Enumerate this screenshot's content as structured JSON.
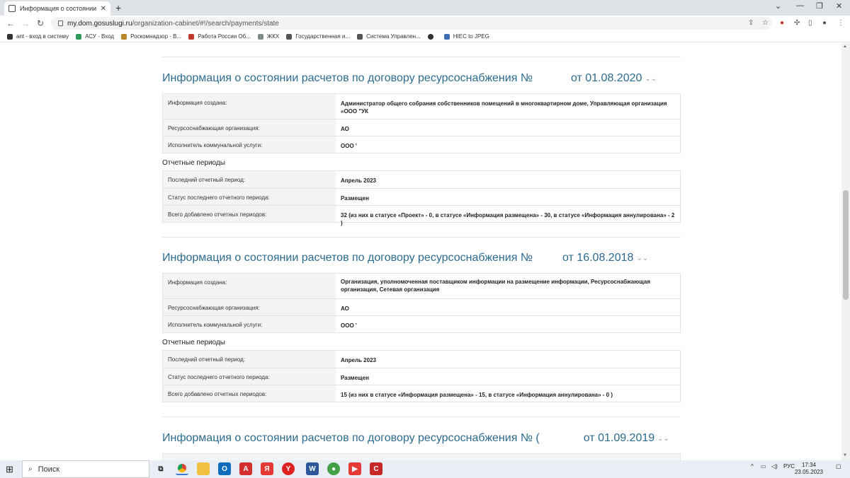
{
  "browser": {
    "tab_title": "Информация о состоянии расч",
    "url_host": "my.dom.gosuslugi.ru",
    "url_path": "/organization-cabinet/#!/search/payments/state",
    "bookmarks": [
      "ant - вход в систему",
      "АСУ - Вход",
      "Роскомнадзор - В...",
      "Работа России Об...",
      "ЖКХ",
      "Государственная и...",
      "Система Управлен...",
      "",
      "HIEC to JPEG"
    ]
  },
  "sections": [
    {
      "title_prefix": "Информация о состоянии расчетов по договору ресурсоснабжения №",
      "title_date": "от 01.08.2020",
      "info_rows": [
        {
          "label": "Информация создана:",
          "value": "Администратор общего собрания собственников помещений в многоквартирном доме, Управляющая организация «ООО \"УК"
        },
        {
          "label": "Ресурсоснабжающая организация:",
          "value": "АО"
        },
        {
          "label": "Исполнитель коммунальной услуги:",
          "value": "ООО '"
        }
      ],
      "periods_heading": "Отчетные периоды",
      "period_rows": [
        {
          "label": "Последний отчетный период:",
          "value": "Апрель 2023"
        },
        {
          "label": "Статус последнего отчетного периода:",
          "value": "Размещен"
        },
        {
          "label": "Всего добавлено отчетных периодов:",
          "value": "32 (из них в статусе «Проект» - 0, в статусе «Информация размещена» - 30, в статусе «Информация аннулирована» - 2 )"
        }
      ]
    },
    {
      "title_prefix": "Информация о состоянии расчетов по договору ресурсоснабжения №",
      "title_date": "от 16.08.2018",
      "info_rows": [
        {
          "label": "Информация создана:",
          "value": "Организация, уполномоченная поставщиком информации на размещение информации, Ресурсоснабжающая организация, Сетевая организация"
        },
        {
          "label": "Ресурсоснабжающая организация:",
          "value": "АО"
        },
        {
          "label": "Исполнитель коммунальной услуги:",
          "value": "ООО '"
        }
      ],
      "periods_heading": "Отчетные периоды",
      "period_rows": [
        {
          "label": "Последний отчетный период:",
          "value": "Апрель 2023"
        },
        {
          "label": "Статус последнего отчетного периода:",
          "value": "Размещен"
        },
        {
          "label": "Всего добавлено отчетных периодов:",
          "value": "15 (из них в статусе «Информация размещена» - 15, в статусе «Информация аннулирована» - 0 )"
        }
      ]
    },
    {
      "title_prefix": "Информация о состоянии расчетов по договору ресурсоснабжения № (",
      "title_date": "от 01.09.2019"
    }
  ],
  "taskbar": {
    "search_placeholder": "Поиск",
    "language": "РУС",
    "time": "17:34",
    "date": "23.05.2023"
  }
}
